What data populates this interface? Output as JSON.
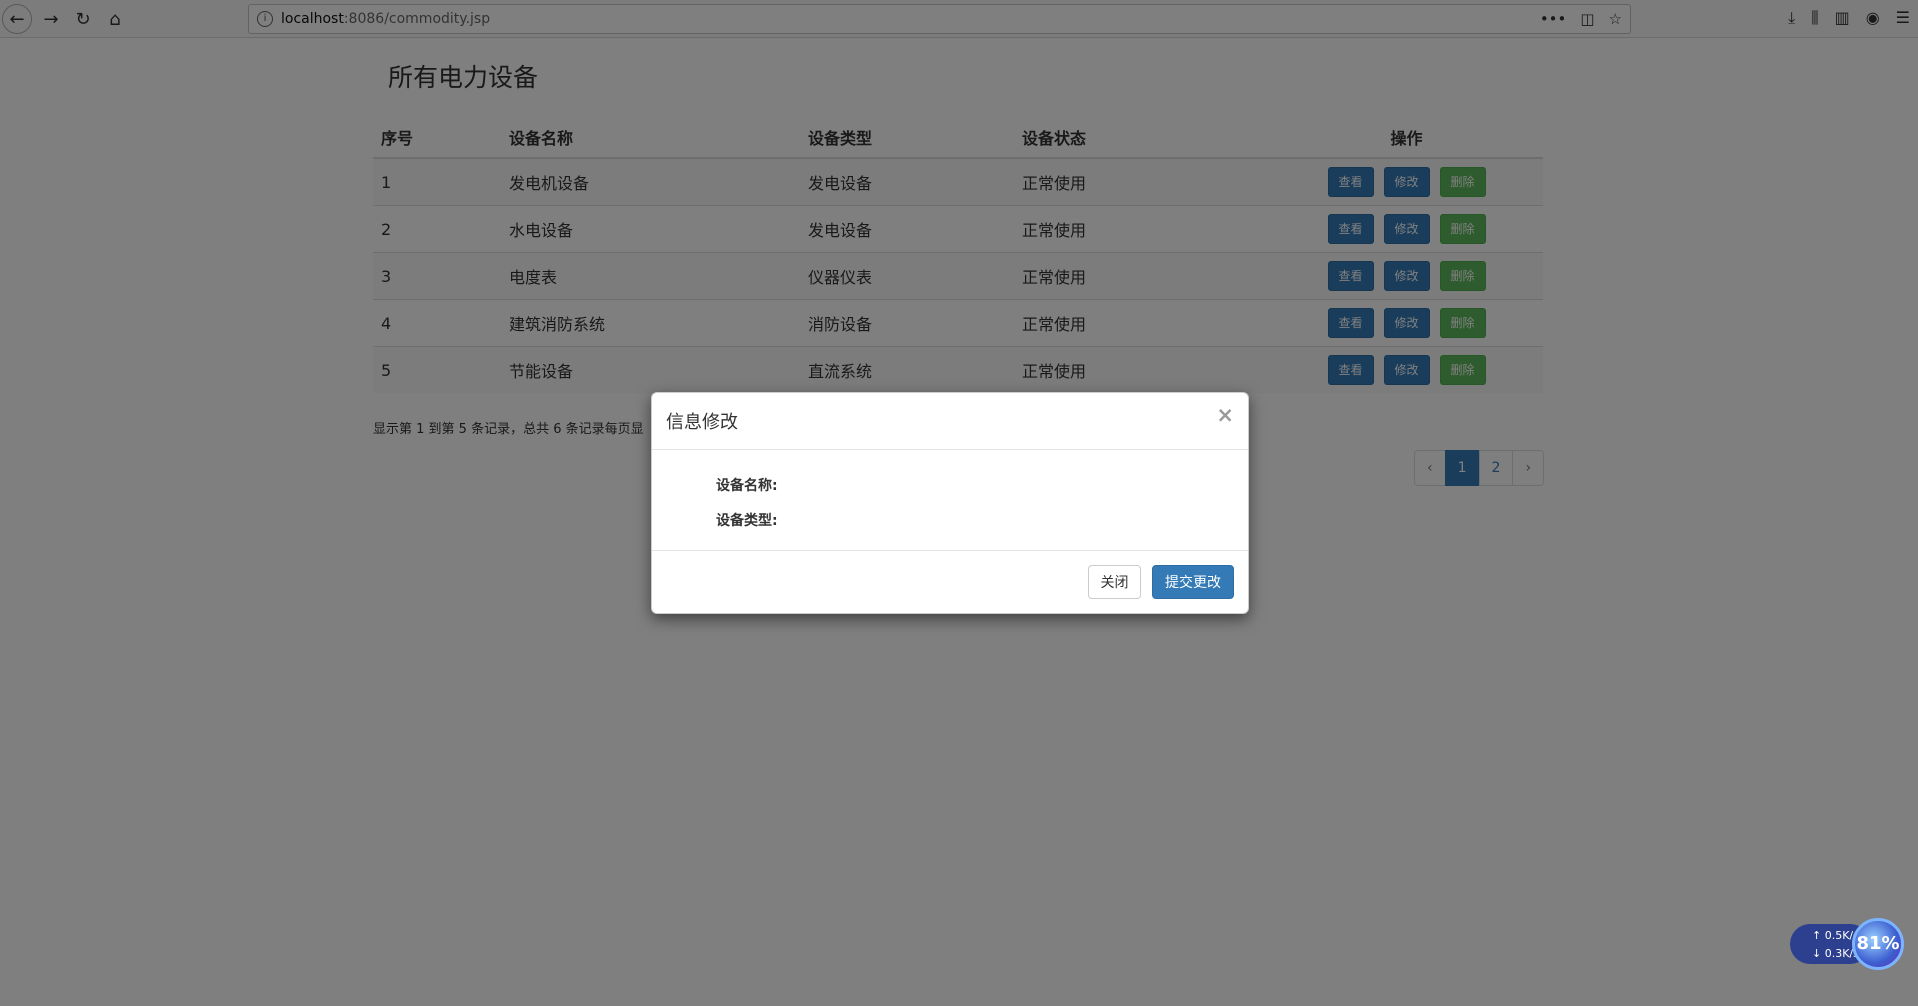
{
  "browser": {
    "url_host": "localhost",
    "url_rest": ":8086/commodity.jsp"
  },
  "page": {
    "title": "所有电力设备",
    "columns": [
      "序号",
      "设备名称",
      "设备类型",
      "设备状态",
      "操作"
    ],
    "rows": [
      {
        "id": "1",
        "name": "发电机设备",
        "type": "发电设备",
        "status": "正常使用"
      },
      {
        "id": "2",
        "name": "水电设备",
        "type": "发电设备",
        "status": "正常使用"
      },
      {
        "id": "3",
        "name": "电度表",
        "type": "仪器仪表",
        "status": "正常使用"
      },
      {
        "id": "4",
        "name": "建筑消防系统",
        "type": "消防设备",
        "status": "正常使用"
      },
      {
        "id": "5",
        "name": "节能设备",
        "type": "直流系统",
        "status": "正常使用"
      }
    ],
    "actions": {
      "view": "查看",
      "edit": "修改",
      "delete": "删除"
    },
    "page_info": "显示第 1 到第 5 条记录，总共 6 条记录每页显",
    "pagination": {
      "prev": "‹",
      "pages": [
        "1",
        "2"
      ],
      "next": "›",
      "active": "1"
    }
  },
  "modal": {
    "title": "信息修改",
    "close_symbol": "×",
    "field_name_label": "设备名称:",
    "field_type_label": "设备类型:",
    "close_button": "关闭",
    "submit_button": "提交更改"
  },
  "netmon": {
    "up": "0.5K/s",
    "down": "0.3K/s",
    "percent": "81%"
  }
}
